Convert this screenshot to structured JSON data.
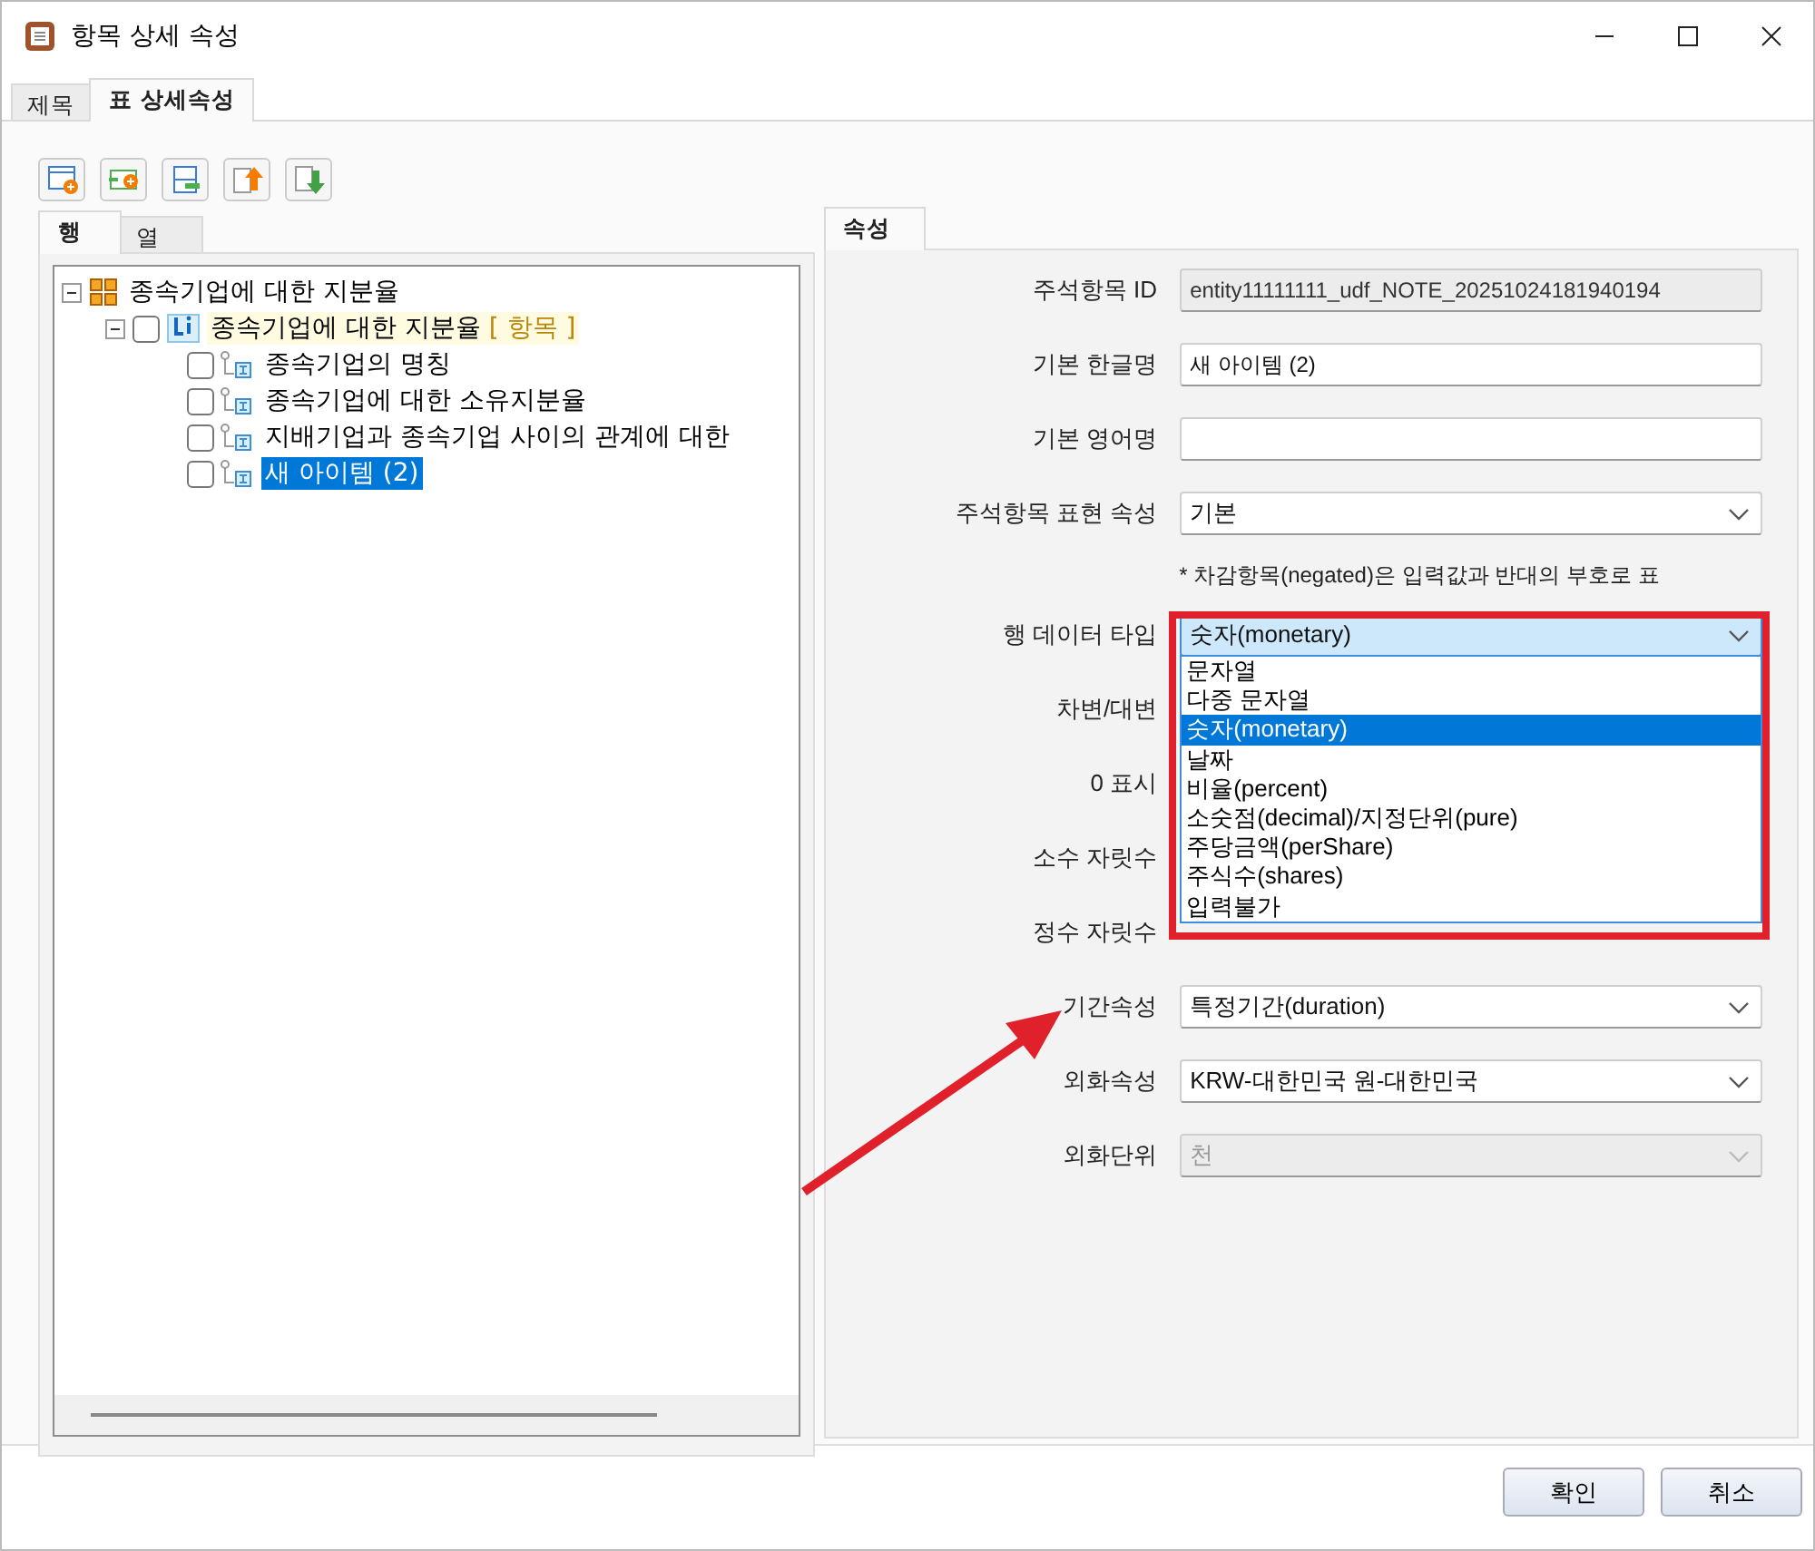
{
  "window": {
    "title": "항목 상세 속성"
  },
  "tabs": [
    {
      "label": "제목",
      "selected": false
    },
    {
      "label": "표 상세속성",
      "selected": true
    }
  ],
  "sub_tabs": [
    {
      "label": "행",
      "selected": true
    },
    {
      "label": "열",
      "selected": false
    }
  ],
  "tree": [
    {
      "label": "종속기업에 대한 지분율",
      "kind": "group",
      "expanded": true,
      "children": [
        {
          "label": "종속기업에 대한 지분율",
          "tag": "[ 항목 ]",
          "kind": "list",
          "checked": false,
          "expanded": true,
          "children": [
            {
              "label": "종속기업의 명칭",
              "kind": "item",
              "checked": false,
              "selected": false
            },
            {
              "label": "종속기업에 대한 소유지분율",
              "kind": "item",
              "checked": false,
              "selected": false
            },
            {
              "label": "지배기업과 종속기업 사이의 관계에 대한",
              "kind": "item",
              "checked": false,
              "selected": false
            },
            {
              "label": "새 아이템 (2)",
              "kind": "item",
              "checked": false,
              "selected": true
            }
          ]
        }
      ]
    }
  ],
  "properties_tab": {
    "label": "속성",
    "selected": true
  },
  "fields": [
    {
      "label": "주석항목 ID",
      "kind": "text",
      "value": "entity11111111_udf_NOTE_20251024181940194",
      "disabled": true
    },
    {
      "label": "기본 한글명",
      "kind": "text",
      "value": "새 아이템 (2)",
      "disabled": false
    },
    {
      "label": "기본 영어명",
      "kind": "text",
      "disabled": false
    },
    {
      "label": "주석항목 표현 속성",
      "kind": "select",
      "value": "기본",
      "disabled": false
    },
    {
      "kind": "note",
      "text": "* 차감항목(negated)은 입력값과 반대의 부호로 표"
    },
    {
      "label": "행 데이터 타입",
      "kind": "select",
      "value": "숫자(monetary)",
      "disabled": false,
      "expanded": true,
      "options": [
        {
          "label": "문자열",
          "selected": false
        },
        {
          "label": "다중 문자열",
          "selected": false
        },
        {
          "label": "숫자(monetary)",
          "selected": true
        },
        {
          "label": "날짜",
          "selected": false
        },
        {
          "label": "비율(percent)",
          "selected": false
        },
        {
          "label": "소숫점(decimal)/지정단위(pure)",
          "selected": false
        },
        {
          "label": "주당금액(perShare)",
          "selected": false
        },
        {
          "label": "주식수(shares)",
          "selected": false
        },
        {
          "label": "입력불가",
          "selected": false
        }
      ]
    },
    {
      "label": "차변/대변",
      "kind": "covered"
    },
    {
      "label": "0 표시",
      "kind": "covered"
    },
    {
      "label": "소수 자릿수",
      "kind": "covered"
    },
    {
      "label": "정수 자릿수",
      "kind": "covered"
    },
    {
      "label": "기간속성",
      "kind": "select",
      "value": "특정기간(duration)",
      "disabled": false
    },
    {
      "label": "외화속성",
      "kind": "select",
      "value": "KRW-대한민국 원-대한민국",
      "disabled": false
    },
    {
      "label": "외화단위",
      "kind": "select",
      "value": "천",
      "disabled": true
    }
  ],
  "buttons": [
    {
      "label": "확인"
    },
    {
      "label": "취소"
    }
  ]
}
